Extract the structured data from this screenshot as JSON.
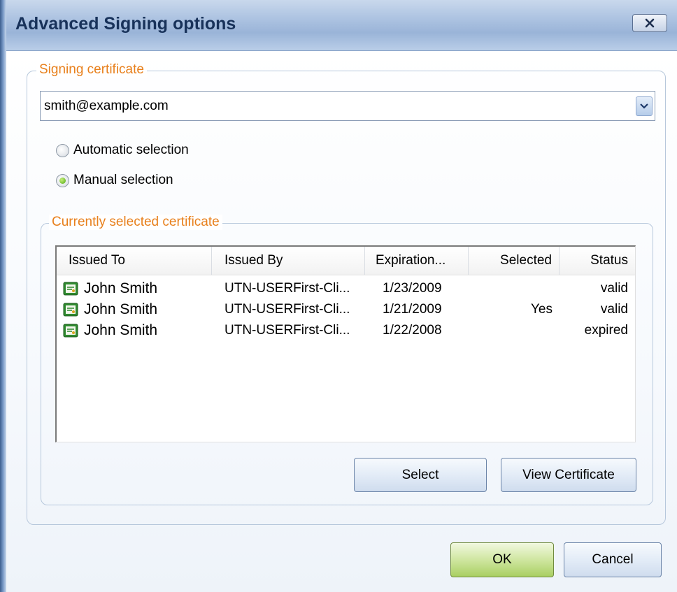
{
  "window": {
    "title": "Advanced Signing options",
    "close_label": "close"
  },
  "signing_certificate": {
    "legend": "Signing certificate",
    "selected_value": "smith@example.com",
    "radios": [
      {
        "label": "Automatic selection",
        "checked": false
      },
      {
        "label": "Manual selection",
        "checked": true
      }
    ]
  },
  "current_certificate": {
    "legend": "Currently selected certificate",
    "columns": [
      "Issued To",
      "Issued By",
      "Expiration...",
      "Selected",
      "Status"
    ],
    "rows": [
      {
        "issued_to": "John Smith",
        "issued_by": "UTN-USERFirst-Cli...",
        "expiration": "1/23/2009",
        "selected": "",
        "status": "valid"
      },
      {
        "issued_to": "John Smith",
        "issued_by": "UTN-USERFirst-Cli...",
        "expiration": "1/21/2009",
        "selected": "Yes",
        "status": "valid"
      },
      {
        "issued_to": "John Smith",
        "issued_by": "UTN-USERFirst-Cli...",
        "expiration": "1/22/2008",
        "selected": "",
        "status": "expired"
      }
    ],
    "select_label": "Select",
    "view_label": "View Certificate"
  },
  "footer": {
    "ok_label": "OK",
    "cancel_label": "Cancel"
  },
  "icons": {
    "close": "close-icon",
    "dropdown": "chevron-down-icon",
    "certificate": "certificate-icon"
  },
  "colors": {
    "legend": "#e8801c",
    "title": "#18325a",
    "ok_button": "#a9cf62"
  }
}
